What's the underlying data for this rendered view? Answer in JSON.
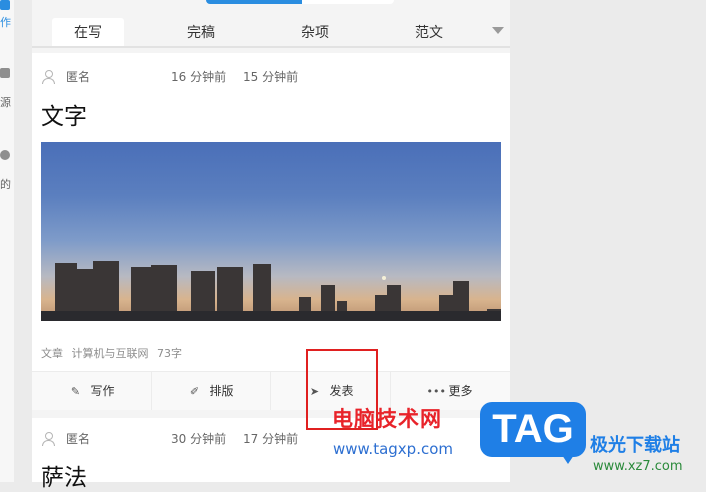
{
  "rail": {
    "items": [
      {
        "label": "作",
        "icon": "write-icon"
      },
      {
        "label": "源",
        "icon": "source-icon"
      },
      {
        "label": "的",
        "icon": "profile-icon"
      }
    ]
  },
  "tabs": [
    {
      "label": "在写",
      "active": true
    },
    {
      "label": "完稿",
      "active": false
    },
    {
      "label": "杂项",
      "active": false
    },
    {
      "label": "范文",
      "active": false
    }
  ],
  "cards": [
    {
      "author": "匿名",
      "created": "16 分钟前",
      "updated": "15 分钟前",
      "title": "文字",
      "type": "文章",
      "category": "计算机与互联网",
      "word_count": "73字"
    },
    {
      "author": "匿名",
      "created": "30 分钟前",
      "updated": "17 分钟前",
      "title": "萨法"
    }
  ],
  "actions": [
    {
      "label": "写作",
      "icon": "pencil-icon"
    },
    {
      "label": "排版",
      "icon": "brush-icon"
    },
    {
      "label": "发表",
      "icon": "send-icon"
    },
    {
      "label": "更多",
      "icon": "more-icon"
    }
  ],
  "watermark": {
    "cn_text": "电脑技术网",
    "url": "www.tagxp.com",
    "logo": "TAG",
    "brand": "极光下载站",
    "site": "www.xz7.com"
  },
  "colors": {
    "accent": "#2a8de0",
    "highlight_box": "#e02020",
    "watermark_red": "#e8232a"
  }
}
